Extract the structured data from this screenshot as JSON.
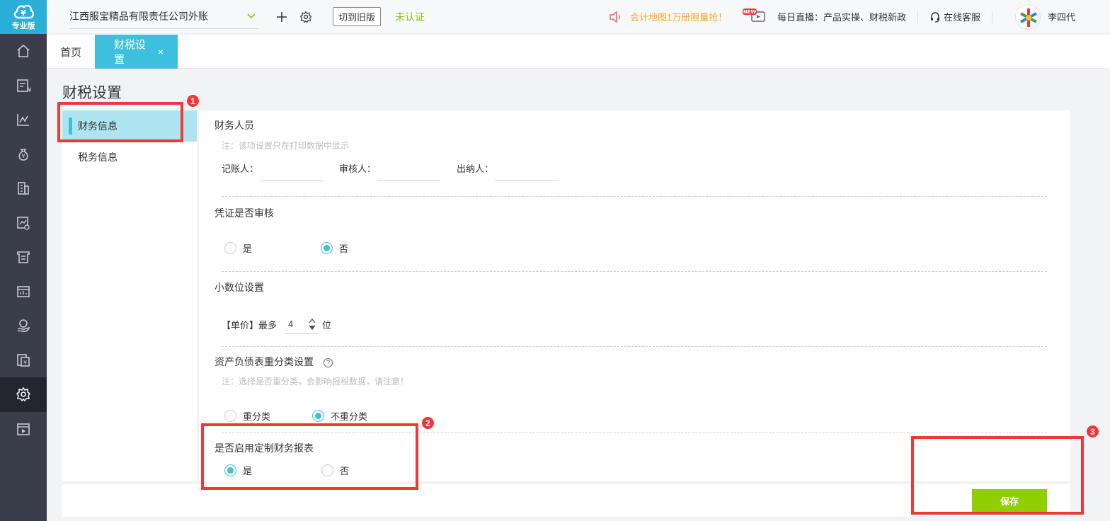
{
  "sidebar": {
    "logo_text": "专业版",
    "items": [
      {
        "name": "home-icon"
      },
      {
        "name": "voucher-icon"
      },
      {
        "name": "chart-icon"
      },
      {
        "name": "money-bag-icon"
      },
      {
        "name": "building-icon"
      },
      {
        "name": "report-icon"
      },
      {
        "name": "invoice-icon"
      },
      {
        "name": "dashboard-icon"
      },
      {
        "name": "coin-hand-icon"
      },
      {
        "name": "tax-icon"
      },
      {
        "name": "gear-icon",
        "active": true
      },
      {
        "name": "video-icon"
      }
    ]
  },
  "header": {
    "company": "江西服宝精品有限责任公司外账",
    "switch_old": "切到旧版",
    "unverified": "未认证",
    "promo": "会计地图1万册限量抢！",
    "new_badge": "NEW",
    "live": "每日直播：产品实操、财税新政",
    "service": "在线客服",
    "user": "李四代"
  },
  "tabs": [
    {
      "label": "首页"
    },
    {
      "label": "财税设置",
      "close": "×"
    }
  ],
  "page_title": "财税设置",
  "subnav": [
    {
      "label": "财务信息"
    },
    {
      "label": "税务信息"
    }
  ],
  "form": {
    "staff": {
      "title": "财务人员",
      "note": "注：该项设置只在打印数据中显示",
      "bookkeeper_label": "记账人：",
      "reviewer_label": "审核人：",
      "cashier_label": "出纳人："
    },
    "voucher_audit": {
      "title": "凭证是否审核",
      "yes": "是",
      "no": "否",
      "selected": "no"
    },
    "decimal": {
      "title": "小数位设置",
      "prefix": "【单价】最多",
      "value": "4",
      "suffix": "位"
    },
    "reclass": {
      "title": "资产负债表重分类设置",
      "help": "?",
      "note": "注：选择是否重分类，会影响报税数据，请注意！",
      "opt_yes": "重分类",
      "opt_no": "不重分类",
      "selected": "no"
    },
    "custom_report": {
      "title": "是否启用定制财务报表",
      "yes": "是",
      "no": "否",
      "selected": "yes"
    }
  },
  "save_label": "保存",
  "annotations": {
    "n1": "1",
    "n2": "2",
    "n3": "3"
  },
  "colors": {
    "accent": "#3cc0dd",
    "save": "#8fcf00",
    "annotation": "#f03838",
    "promo": "#f5a623",
    "unverified": "#8fc31f"
  }
}
